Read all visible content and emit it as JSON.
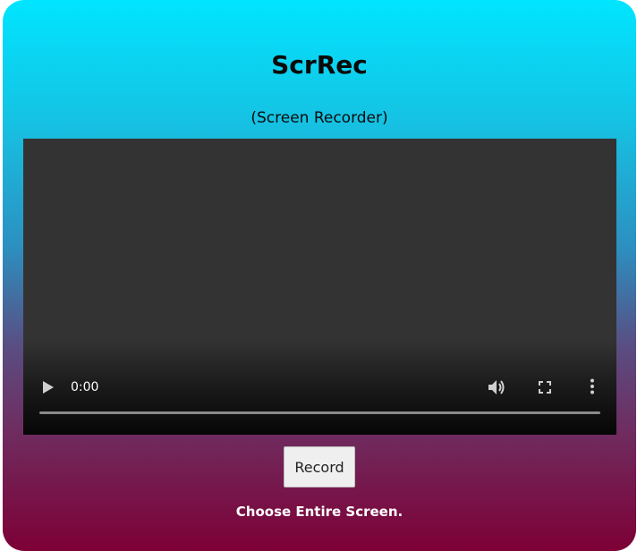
{
  "app": {
    "title": "ScrRec",
    "subtitle": "(Screen Recorder)"
  },
  "video": {
    "current_time": "0:00",
    "progress": 0,
    "controls": {
      "play_icon": "play-icon",
      "volume_icon": "volume-icon",
      "fullscreen_icon": "fullscreen-icon",
      "more_icon": "more-vertical-icon"
    }
  },
  "record_button": {
    "label": "Record"
  },
  "hint": {
    "text": "Choose Entire Screen."
  },
  "colors": {
    "gradient_top": "#00e5ff",
    "gradient_bottom": "#7d0036",
    "video_background": "#333333",
    "control_icon": "#cfcfcf"
  }
}
